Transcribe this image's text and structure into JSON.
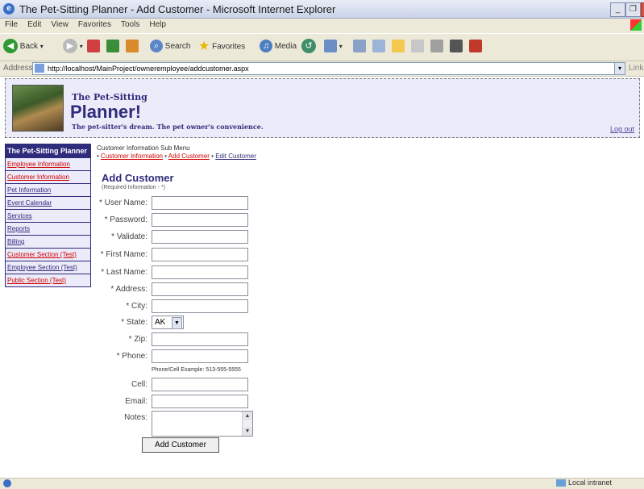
{
  "window": {
    "title": "The Pet-Sitting Planner - Add Customer - Microsoft Internet Explorer",
    "min_glyph": "_",
    "max_glyph": "❐",
    "close_glyph": "×"
  },
  "menubar": [
    "File",
    "Edit",
    "View",
    "Favorites",
    "Tools",
    "Help"
  ],
  "toolbar": {
    "back_label": "Back",
    "search_label": "Search",
    "favorites_label": "Favorites",
    "media_label": "Media"
  },
  "addressbar": {
    "label": "Address",
    "url": "http://localhost/MainProject/owneremployee/addcustomer.aspx",
    "links_label": "Links"
  },
  "header": {
    "title_small": "The Pet-Sitting",
    "title_big": "Planner!",
    "tagline": "The pet-sitter's dream. The pet owner's convenience.",
    "logout": "Log out"
  },
  "sidebar": {
    "heading": "The Pet-Sitting Planner",
    "items": [
      {
        "label": "Employee Information",
        "color": "red"
      },
      {
        "label": "Customer Information",
        "color": "red"
      },
      {
        "label": "Pet Information",
        "color": "blue"
      },
      {
        "label": "Event Calendar",
        "color": "blue"
      },
      {
        "label": "Services",
        "color": "blue"
      },
      {
        "label": "Reports",
        "color": "blue"
      },
      {
        "label": "Billing",
        "color": "blue"
      },
      {
        "label": "Customer Section (Test)",
        "color": "red"
      },
      {
        "label": "Employee Section (Test)",
        "color": "blue"
      },
      {
        "label": "Public Section (Test)",
        "color": "red"
      }
    ]
  },
  "submenu": {
    "title": "Customer Information Sub Menu",
    "bullet": "•",
    "links": [
      "Customer Information",
      "Add Customer",
      "Edit Customer"
    ]
  },
  "form": {
    "title": "Add Customer",
    "required_note": "(Required Information - *)",
    "fields": [
      {
        "label": "* User Name:",
        "value": ""
      },
      {
        "label": "* Password:",
        "value": ""
      },
      {
        "label": "* Validate:",
        "value": ""
      },
      {
        "label": "* First Name:",
        "value": ""
      },
      {
        "label": "* Last Name:",
        "value": ""
      },
      {
        "label": "* Address:",
        "value": ""
      },
      {
        "label": "* City:",
        "value": ""
      }
    ],
    "state_label": "* State:",
    "state_value": "AK",
    "zip_label": "* Zip:",
    "phone_label": "* Phone:",
    "phone_example": "Phone/Cell Example: 513-555-5555",
    "cell_label": "Cell:",
    "email_label": "Email:",
    "notes_label": "Notes:",
    "submit_label": "Add Customer"
  },
  "statusbar": {
    "zone": "Local intranet"
  },
  "colors": {
    "brand": "#302c7c",
    "header_bg": "#ebebf9",
    "link_red": "#d10000"
  }
}
